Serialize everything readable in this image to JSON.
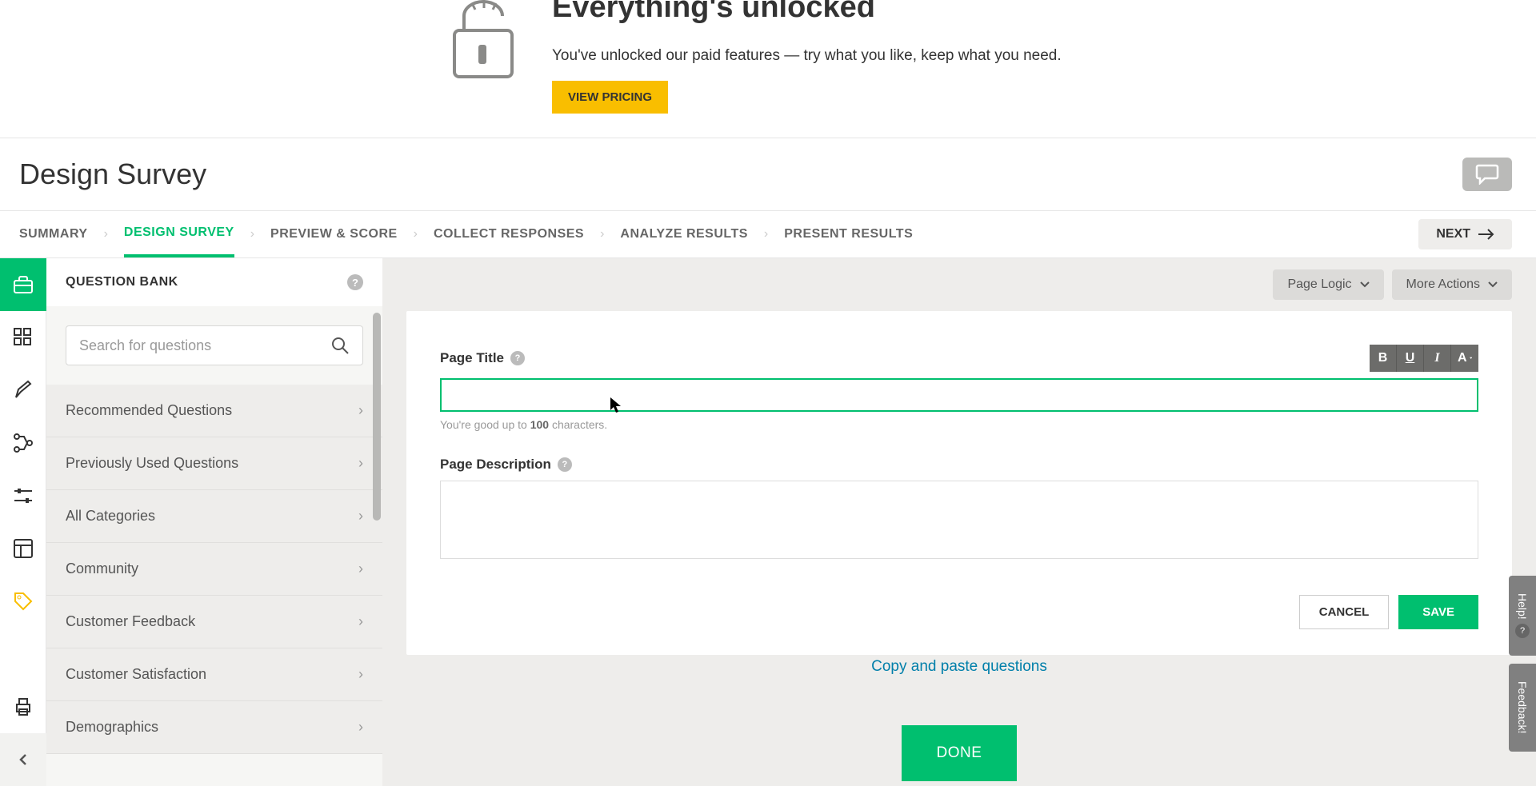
{
  "banner": {
    "title": "Everything's unlocked",
    "subtitle": "You've unlocked our paid features — try what you like, keep what you need.",
    "cta": "VIEW PRICING"
  },
  "page": {
    "title": "Design Survey"
  },
  "nav": {
    "steps": [
      "SUMMARY",
      "DESIGN SURVEY",
      "PREVIEW & SCORE",
      "COLLECT RESPONSES",
      "ANALYZE RESULTS",
      "PRESENT RESULTS"
    ],
    "active_index": 1,
    "next": "NEXT"
  },
  "sidebar": {
    "title": "QUESTION BANK",
    "search_placeholder": "Search for questions",
    "categories": [
      "Recommended Questions",
      "Previously Used Questions",
      "All Categories",
      "Community",
      "Customer Feedback",
      "Customer Satisfaction",
      "Demographics"
    ]
  },
  "page_actions": {
    "logic": "Page Logic",
    "more": "More Actions"
  },
  "editor": {
    "title_label": "Page Title",
    "title_value": "",
    "char_hint_pre": "You're good up to ",
    "char_hint_num": "100",
    "char_hint_post": " characters.",
    "desc_label": "Page Description",
    "desc_value": "",
    "cancel": "CANCEL",
    "save": "SAVE"
  },
  "format": {
    "bold": "B",
    "underline": "U",
    "italic": "I",
    "color": "A"
  },
  "main": {
    "copy_paste": "Copy and paste questions",
    "done": "DONE"
  },
  "side_tabs": {
    "help": "Help!",
    "feedback": "Feedback!"
  },
  "icons": {
    "help_q": "?"
  }
}
